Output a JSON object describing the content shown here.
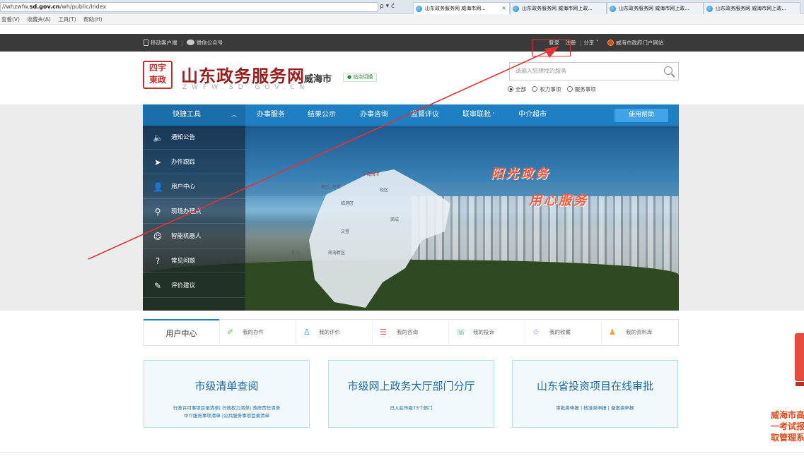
{
  "browser": {
    "url_prefix": "//whzwfw.",
    "url_domain": "sd.gov.cn",
    "url_path": "/wh/public/index",
    "addr_tools": "ρ ▾ ć",
    "tabs": [
      {
        "title": "山东政务服务网 威海市网...",
        "close": "×"
      },
      {
        "title": "山东政务服务网 威海市网上政..."
      },
      {
        "title": "山东政务服务网 威海市网上政..."
      },
      {
        "title": "山东政务服务网 威海市网上政..."
      }
    ],
    "menu": [
      "查看(V)",
      "收藏夹(A)",
      "工具(T)",
      "帮助(H)"
    ]
  },
  "topbar": {
    "mobile": "移动客户端",
    "separator": "|",
    "wechat": "微信公众号",
    "login": "登录",
    "register": "注册",
    "share": "分享",
    "gov_portal": "威海市政府门户网站"
  },
  "header": {
    "seal_top": "四宇",
    "seal_bottom": "東政",
    "title": "山东政务服务网",
    "domain": "ZWFW.SD.GOV.CN",
    "city": "威海市",
    "switch": "站点切换",
    "search_placeholder": "请输入您想找的服务",
    "scope": [
      "全部",
      "权力事项",
      "服务事项"
    ]
  },
  "nav": {
    "quick": "快捷工具",
    "items": [
      "办事服务",
      "结果公示",
      "办事咨询",
      "监督评议",
      "联审联批",
      "中介超市"
    ],
    "help": "使用帮助"
  },
  "sidebar": [
    {
      "icon": "speaker-icon",
      "glyph": "🔈",
      "label": "通知公告"
    },
    {
      "icon": "send-icon",
      "glyph": "➤",
      "label": "办件跟踪"
    },
    {
      "icon": "user-icon",
      "glyph": "👤",
      "label": "用户中心"
    },
    {
      "icon": "person-location-icon",
      "glyph": "⚲",
      "label": "现场办理点"
    },
    {
      "icon": "robot-icon",
      "glyph": "☺",
      "label": "智能机器人"
    },
    {
      "icon": "question-icon",
      "glyph": "?",
      "label": "常见问题"
    },
    {
      "icon": "edit-icon",
      "glyph": "✎",
      "label": "评价建议"
    }
  ],
  "banner": {
    "slogan1": "阳光政务",
    "slogan2": "用心服务",
    "map_labels": [
      "威海市",
      "环翠",
      "经区",
      "临港区",
      "高区",
      "南海新区",
      "文登",
      "乳山",
      "荣成"
    ]
  },
  "user_tabs": {
    "first": "用户中心",
    "items": [
      {
        "icon": "pencil-icon",
        "glyph": "✐",
        "label": "我的办件"
      },
      {
        "icon": "bulb-icon",
        "glyph": "♙",
        "label": "我的评价"
      },
      {
        "icon": "message-icon",
        "glyph": "☰",
        "label": "我的咨询"
      },
      {
        "icon": "phone-icon",
        "glyph": "☏",
        "label": "我的投诉"
      },
      {
        "icon": "star-icon",
        "glyph": "☆",
        "label": "我的收藏"
      },
      {
        "icon": "profile-icon",
        "glyph": "♟",
        "label": "我的资料库"
      }
    ]
  },
  "cards": [
    {
      "title": "市级清单查阅",
      "sub1": "行政许可事项目录清单| 行政权力清单| 政府责任清单",
      "sub2": "中介服务事项清单 |公共服务事项目录清单"
    },
    {
      "title": "市级网上政务大厅部门分厅",
      "sub1": "已入驻市级73个部门",
      "sub2": ""
    },
    {
      "title": "山东省投资项目在线审批",
      "sub1": "审批类申报 | 核准类申报 | 备案类申报",
      "sub2": ""
    }
  ],
  "promo": {
    "line1": "威海市高",
    "line2": "一考试报",
    "line3": "取管理系"
  },
  "colors": {
    "nav_blue": "#1e7fc2",
    "title_red": "#9a1f1d",
    "slogan": "#ff5a3c",
    "annotation": "#e53232"
  }
}
